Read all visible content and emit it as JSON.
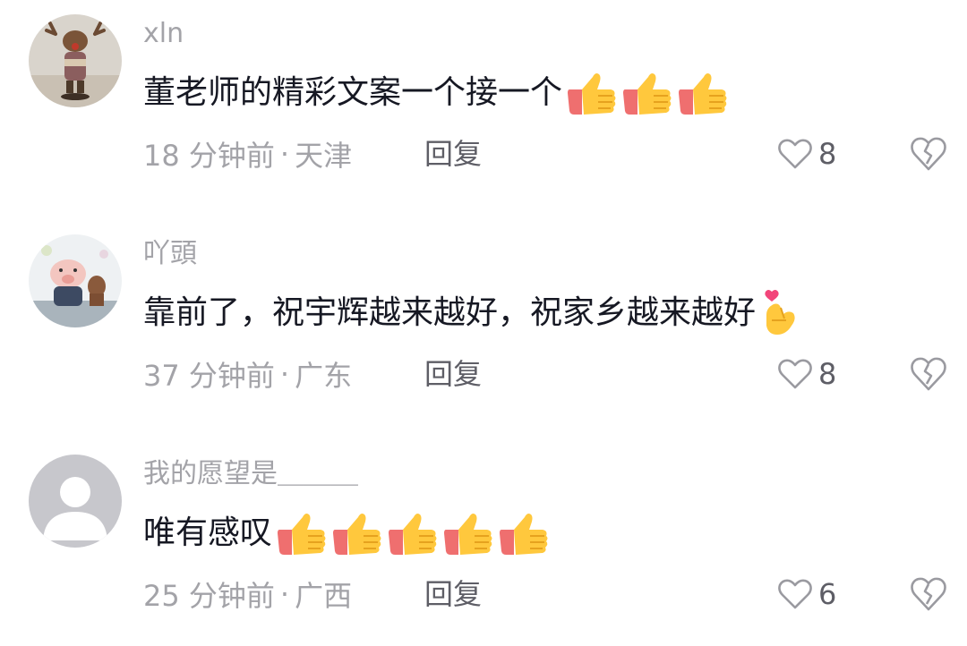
{
  "comments": [
    {
      "username": "xln",
      "text": "董老师的精彩文案一个接一个",
      "time": "18 分钟前",
      "separator": "·",
      "location": "天津",
      "reply_label": "回复",
      "likes": "8",
      "emojis": [
        "thumbs-up-icon",
        "thumbs-up-icon",
        "thumbs-up-icon"
      ]
    },
    {
      "username": "吖頭",
      "text": "靠前了，祝宇辉越来越好，祝家乡越来越好",
      "time": "37 分钟前",
      "separator": "·",
      "location": "广东",
      "reply_label": "回复",
      "likes": "8",
      "emojis": [
        "finger-heart-icon"
      ]
    },
    {
      "username": "我的愿望是＿＿＿",
      "text": "唯有感叹",
      "time": "25 分钟前",
      "separator": "·",
      "location": "广西",
      "reply_label": "回复",
      "likes": "6",
      "emojis": [
        "thumbs-up-icon",
        "thumbs-up-icon",
        "thumbs-up-icon",
        "thumbs-up-icon",
        "thumbs-up-icon"
      ]
    }
  ],
  "colors": {
    "username": "#a3a3a8",
    "text": "#161823",
    "meta": "#a3a3a8",
    "reply": "#5e5e66",
    "thumb_yellow": "#ffc83d",
    "thumb_sleeve": "#ef6f6f"
  }
}
